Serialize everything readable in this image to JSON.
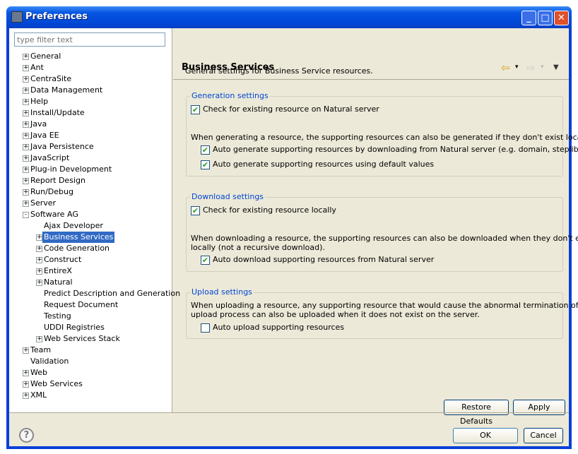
{
  "window": {
    "title": "Preferences",
    "minimize": "_",
    "maximize": "□",
    "close": "✕"
  },
  "filter": {
    "placeholder": "type filter text"
  },
  "tree": [
    {
      "label": "General",
      "level": 0,
      "expander": "+"
    },
    {
      "label": "Ant",
      "level": 0,
      "expander": "+"
    },
    {
      "label": "CentraSite",
      "level": 0,
      "expander": "+"
    },
    {
      "label": "Data Management",
      "level": 0,
      "expander": "+"
    },
    {
      "label": "Help",
      "level": 0,
      "expander": "+"
    },
    {
      "label": "Install/Update",
      "level": 0,
      "expander": "+"
    },
    {
      "label": "Java",
      "level": 0,
      "expander": "+"
    },
    {
      "label": "Java EE",
      "level": 0,
      "expander": "+"
    },
    {
      "label": "Java Persistence",
      "level": 0,
      "expander": "+"
    },
    {
      "label": "JavaScript",
      "level": 0,
      "expander": "+"
    },
    {
      "label": "Plug-in Development",
      "level": 0,
      "expander": "+"
    },
    {
      "label": "Report Design",
      "level": 0,
      "expander": "+"
    },
    {
      "label": "Run/Debug",
      "level": 0,
      "expander": "+"
    },
    {
      "label": "Server",
      "level": 0,
      "expander": "+"
    },
    {
      "label": "Software AG",
      "level": 0,
      "expander": "-"
    },
    {
      "label": "Ajax Developer",
      "level": 1,
      "expander": ""
    },
    {
      "label": "Business Services",
      "level": 1,
      "expander": "+",
      "selected": true
    },
    {
      "label": "Code Generation",
      "level": 1,
      "expander": "+"
    },
    {
      "label": "Construct",
      "level": 1,
      "expander": "+"
    },
    {
      "label": "EntireX",
      "level": 1,
      "expander": "+"
    },
    {
      "label": "Natural",
      "level": 1,
      "expander": "+"
    },
    {
      "label": "Predict Description and Generation",
      "level": 1,
      "expander": ""
    },
    {
      "label": "Request Document",
      "level": 1,
      "expander": ""
    },
    {
      "label": "Testing",
      "level": 1,
      "expander": ""
    },
    {
      "label": "UDDI Registries",
      "level": 1,
      "expander": ""
    },
    {
      "label": "Web Services Stack",
      "level": 1,
      "expander": "+"
    },
    {
      "label": "Team",
      "level": 0,
      "expander": "+"
    },
    {
      "label": "Validation",
      "level": 0,
      "expander": ""
    },
    {
      "label": "Web",
      "level": 0,
      "expander": "+"
    },
    {
      "label": "Web Services",
      "level": 0,
      "expander": "+"
    },
    {
      "label": "XML",
      "level": 0,
      "expander": "+"
    }
  ],
  "page": {
    "title": "Business Services",
    "nav": {
      "back": "⇦",
      "forward": "⇨",
      "menu": "▼",
      "dropdown": "▾"
    },
    "description": "General settings for Business Service resources.",
    "generation": {
      "title": "Generation settings",
      "check_existing": {
        "label": "Check for existing resource on Natural server",
        "checked": true
      },
      "note": "When generating a resource, the supporting resources can also be generated if they don't exist locally.",
      "auto_download": {
        "label": "Auto generate supporting resources by downloading from Natural server (e.g. domain, steplib)",
        "checked": true
      },
      "auto_default": {
        "label": "Auto generate supporting resources using default values",
        "checked": true
      }
    },
    "download": {
      "title": "Download settings",
      "check_local": {
        "label": "Check for existing resource locally",
        "checked": true
      },
      "note1": "When downloading a resource, the supporting resources can also be downloaded when they don't exist",
      "note2": "locally (not a recursive download).",
      "auto_download": {
        "label": "Auto download supporting resources from Natural server",
        "checked": true
      }
    },
    "upload": {
      "title": "Upload settings",
      "note1": "When uploading a resource, any supporting resource that would cause the abnormal termination of the",
      "note2": "upload process can also be uploaded when it does not exist on the server.",
      "auto_upload": {
        "label": "Auto upload supporting resources",
        "checked": false
      }
    },
    "restore_defaults": "Restore Defaults",
    "apply": "Apply"
  },
  "footer": {
    "help": "?",
    "ok": "OK",
    "cancel": "Cancel"
  }
}
